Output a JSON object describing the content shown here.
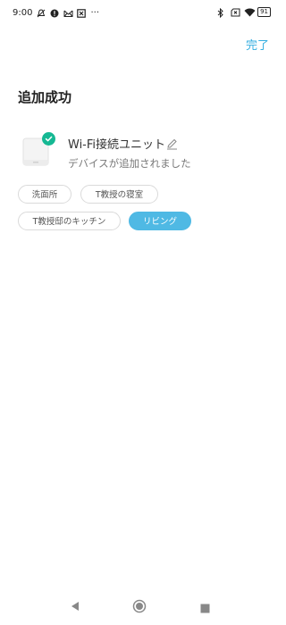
{
  "status_bar": {
    "time": "9:00",
    "left_icons": [
      "bell-off-icon",
      "alert-icon",
      "mail-icon",
      "close-box-icon",
      "more-dots-icon"
    ],
    "right_icons": [
      "bluetooth-icon",
      "sim-off-icon",
      "wifi-icon",
      "battery-icon"
    ],
    "battery_level": "91",
    "more_dots": "···"
  },
  "header": {
    "done_label": "完了"
  },
  "page": {
    "title": "追加成功"
  },
  "device": {
    "name": "Wi-Fi接続ユニット",
    "status": "デバイスが追加されました",
    "check_color": "#15b893"
  },
  "rooms": [
    {
      "label": "洗面所",
      "selected": false
    },
    {
      "label": "T教授の寝室",
      "selected": false
    },
    {
      "label": "T教授邸のキッチン",
      "selected": false
    },
    {
      "label": "リビング",
      "selected": true
    }
  ],
  "colors": {
    "accent": "#35aee0",
    "chip_selected": "#4fb9e4"
  },
  "nav_bar": {
    "icons": [
      "back-icon",
      "home-icon",
      "recents-icon"
    ]
  }
}
